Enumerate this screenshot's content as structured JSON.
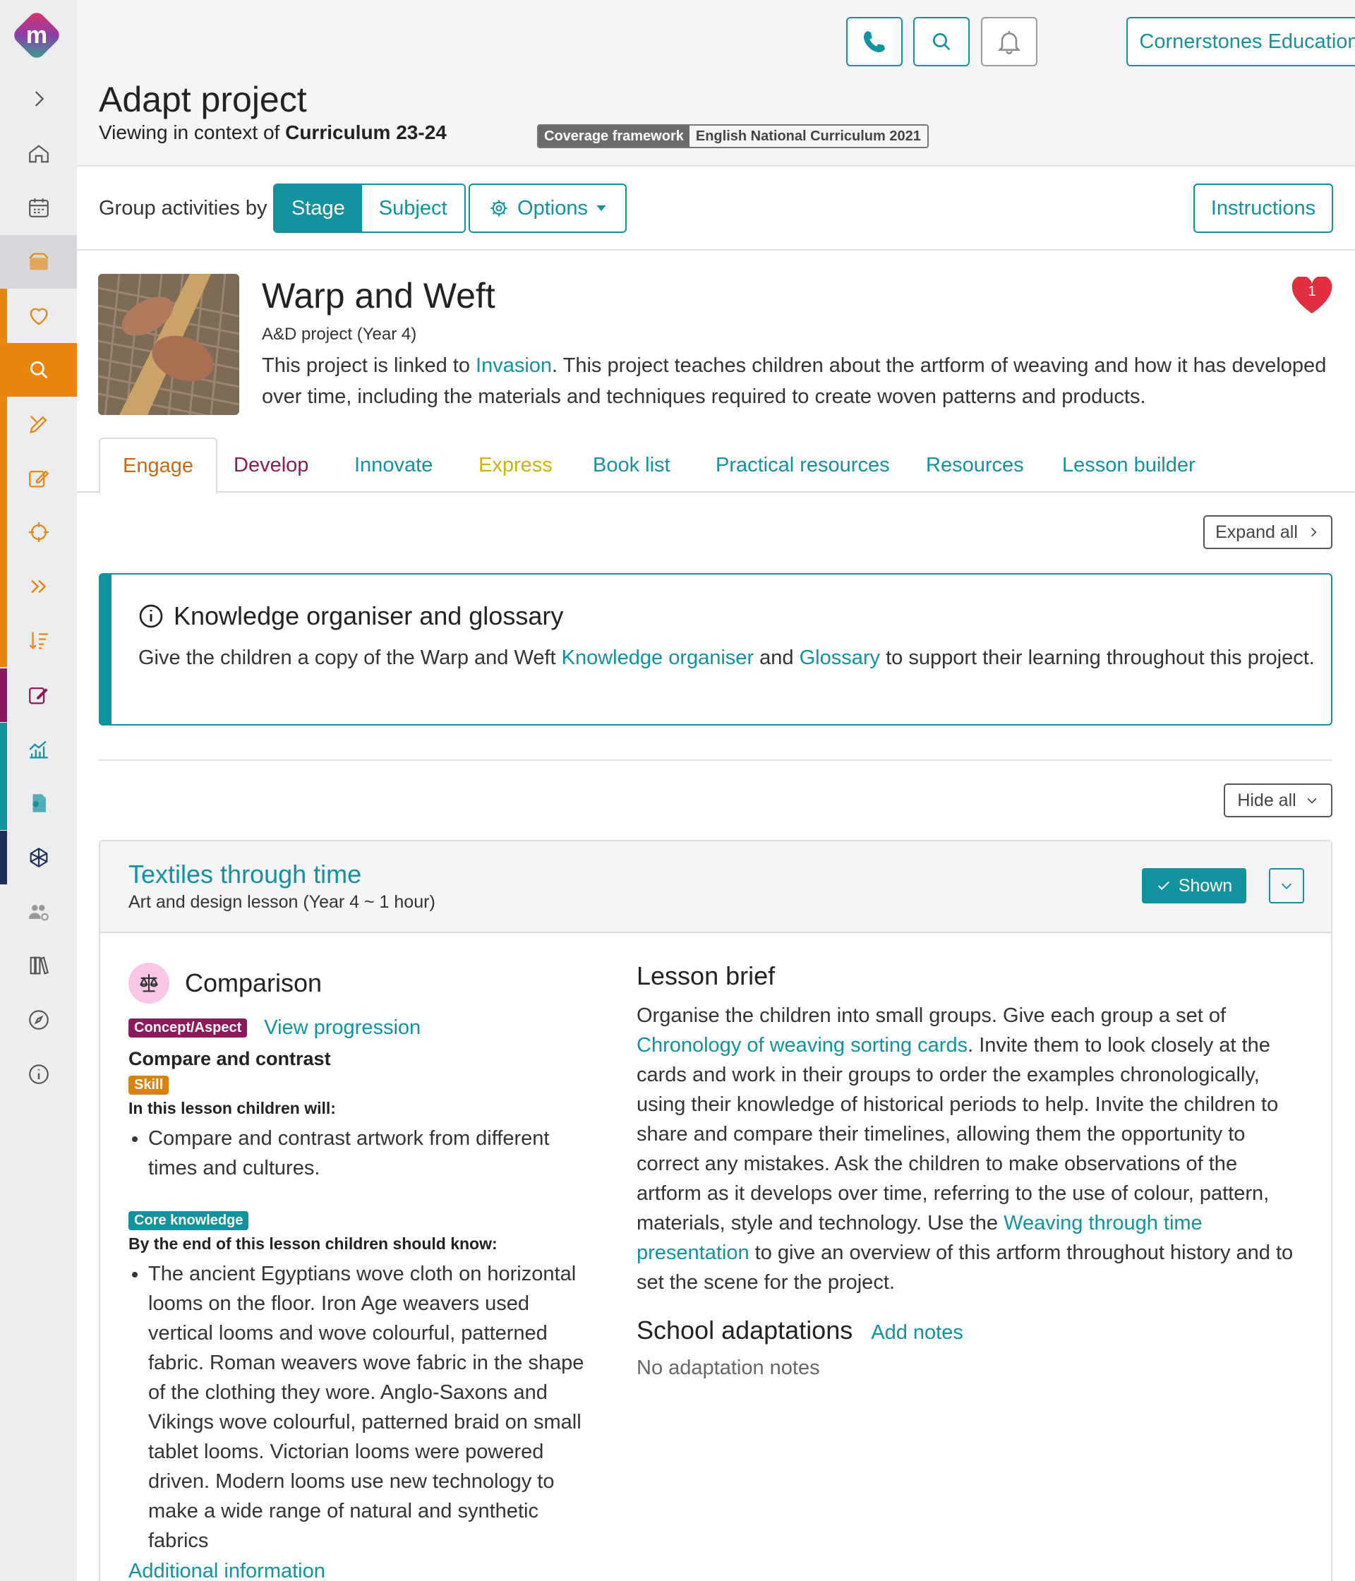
{
  "header": {
    "school_name": "Cornerstones Education",
    "page_title": "Adapt project",
    "context_prefix": "Viewing in context of",
    "context_value": "Curriculum 23-24",
    "framework_key": "Coverage framework",
    "framework_value": "English National Curriculum 2021"
  },
  "toolbar": {
    "group_label": "Group activities by",
    "stage_label": "Stage",
    "subject_label": "Subject",
    "options_label": "Options",
    "instructions_label": "Instructions"
  },
  "project": {
    "title": "Warp and Weft",
    "subtitle": "A&D project (Year 4)",
    "desc_before": "This project is linked to ",
    "desc_link": "Invasion",
    "desc_after": ". This project teaches children about the artform of weaving and how it has developed over time, including the materials and techniques required to create woven patterns and products.",
    "favourite_count": "1"
  },
  "tabs": [
    {
      "label": "Engage",
      "color": "#c8690b"
    },
    {
      "label": "Develop",
      "color": "#8a1a5c"
    },
    {
      "label": "Innovate",
      "color": "#12919f"
    },
    {
      "label": "Express",
      "color": "#c9b40f"
    },
    {
      "label": "Book list",
      "color": "#12919f"
    },
    {
      "label": "Practical resources",
      "color": "#12919f"
    },
    {
      "label": "Resources",
      "color": "#12919f"
    },
    {
      "label": "Lesson builder",
      "color": "#12919f"
    }
  ],
  "expand_all_label": "Expand all",
  "hide_all_label": "Hide all",
  "info_box": {
    "title": "Knowledge organiser and glossary",
    "text_before": "Give the children a copy of the Warp and Weft ",
    "link1": "Knowledge organiser",
    "text_mid": " and ",
    "link2": "Glossary",
    "text_after": " to support their learning throughout this project."
  },
  "lesson": {
    "title": "Textiles through time",
    "meta": "Art and design lesson (Year 4 ~ 1 hour)",
    "shown_label": "Shown",
    "concept_name": "Comparison",
    "concept_badge": "Concept/Aspect",
    "view_progression": "View progression",
    "skill_name": "Compare and contrast",
    "skill_badge": "Skill",
    "will_label": "In this lesson children will:",
    "will_items": [
      "Compare and contrast artwork from different times and cultures."
    ],
    "core_badge": "Core knowledge",
    "know_label": "By the end of this lesson children should know:",
    "know_items": [
      "The ancient Egyptians wove cloth on horizontal looms on the floor. Iron Age weavers used vertical looms and wove colourful, patterned fabric. Roman weavers wove fabric in the shape of the clothing they wore. Anglo-Saxons and Vikings wove colourful, patterned braid on small tablet looms. Victorian looms were powered driven. Modern looms use new technology to make a wide range of natural and synthetic fabrics"
    ],
    "additional_info": "Additional information",
    "brief_title": "Lesson brief",
    "brief_p1": "Organise the children into small groups. Give each group a set of ",
    "brief_link1": "Chronology of weaving sorting cards",
    "brief_p2": ". Invite them to look closely at the cards and work in their groups to order the examples chronologically, using their knowledge of historical periods to help. Invite the children to share and compare their timelines, allowing them the opportunity to correct any mistakes. Ask the children to make observations of the artform as it develops over time, referring to the use of colour, pattern, materials, style and technology. Use the ",
    "brief_link2": "Weaving through time presentation",
    "brief_p3": " to give an overview of this artform throughout history and to set the scene for the project.",
    "adapt_title": "School adaptations",
    "add_notes": "Add notes",
    "no_notes": "No adaptation notes"
  },
  "icons": [
    "phone-icon",
    "search-icon",
    "bell-icon",
    "chevron-down-icon",
    "gear-icon",
    "heart-icon",
    "info-icon",
    "scales-icon",
    "check-icon"
  ]
}
